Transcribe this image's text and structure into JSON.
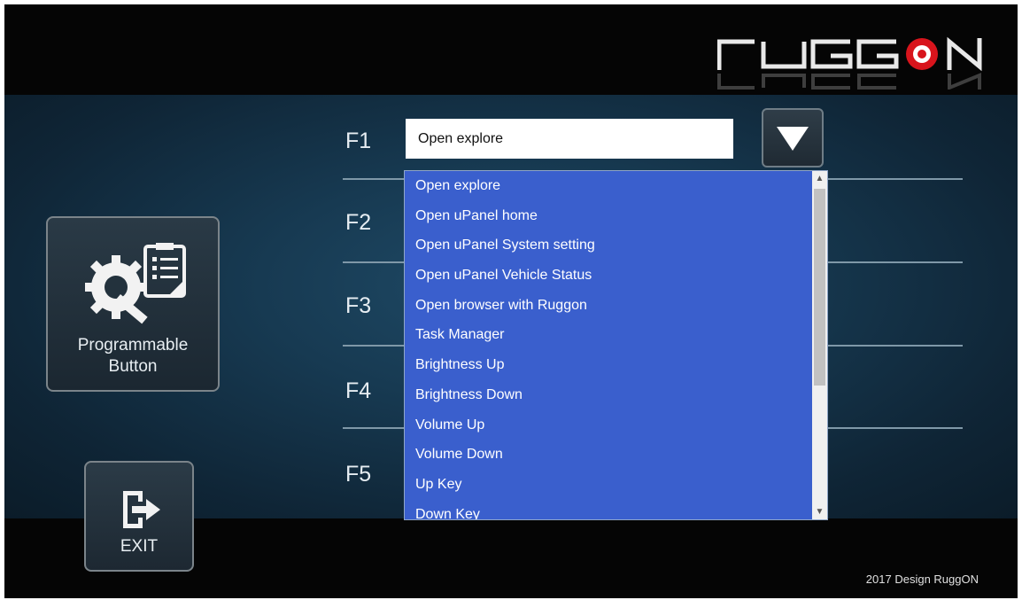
{
  "brand": {
    "logo_text": "RUGGON"
  },
  "sidebar": {
    "programmable_button": {
      "label_line1": "Programmable",
      "label_line2": "Button"
    },
    "exit_button": {
      "label": "EXIT"
    }
  },
  "fkeys": [
    "F1",
    "F2",
    "F3",
    "F4",
    "F5"
  ],
  "f1_combo": {
    "value": "Open explore",
    "options": [
      "Open explore",
      "Open uPanel home",
      "Open uPanel System setting",
      "Open uPanel Vehicle Status",
      "Open browser with Ruggon",
      "Task Manager",
      "Brightness Up",
      "Brightness Down",
      "Volume Up",
      "Volume Down",
      "Up Key",
      "Down Key"
    ]
  },
  "footer": {
    "text": "2017 Design RuggON"
  },
  "colors": {
    "dropdown_bg": "#3a5fcd",
    "logo_accent": "#d8141c"
  }
}
